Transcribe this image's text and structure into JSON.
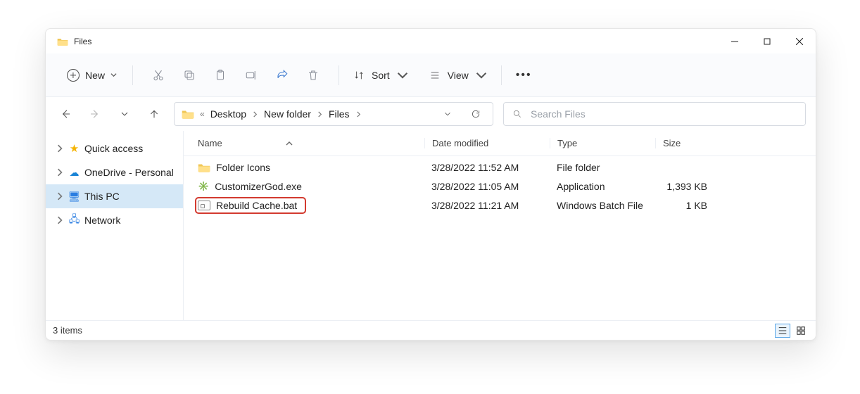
{
  "window": {
    "title": "Files"
  },
  "toolbar": {
    "new_label": "New",
    "sort_label": "Sort",
    "view_label": "View"
  },
  "breadcrumb": {
    "seg1": "Desktop",
    "seg2": "New folder",
    "seg3": "Files"
  },
  "search": {
    "placeholder": "Search Files"
  },
  "sidebar": {
    "quick_access": "Quick access",
    "onedrive": "OneDrive - Personal",
    "this_pc": "This PC",
    "network": "Network"
  },
  "columns": {
    "name": "Name",
    "modified": "Date modified",
    "type": "Type",
    "size": "Size"
  },
  "files": {
    "r0": {
      "name": "Folder Icons",
      "modified": "3/28/2022 11:52 AM",
      "type": "File folder",
      "size": ""
    },
    "r1": {
      "name": "CustomizerGod.exe",
      "modified": "3/28/2022 11:05 AM",
      "type": "Application",
      "size": "1,393 KB"
    },
    "r2": {
      "name": "Rebuild Cache.bat",
      "modified": "3/28/2022 11:21 AM",
      "type": "Windows Batch File",
      "size": "1 KB"
    }
  },
  "status": {
    "count": "3 items"
  }
}
